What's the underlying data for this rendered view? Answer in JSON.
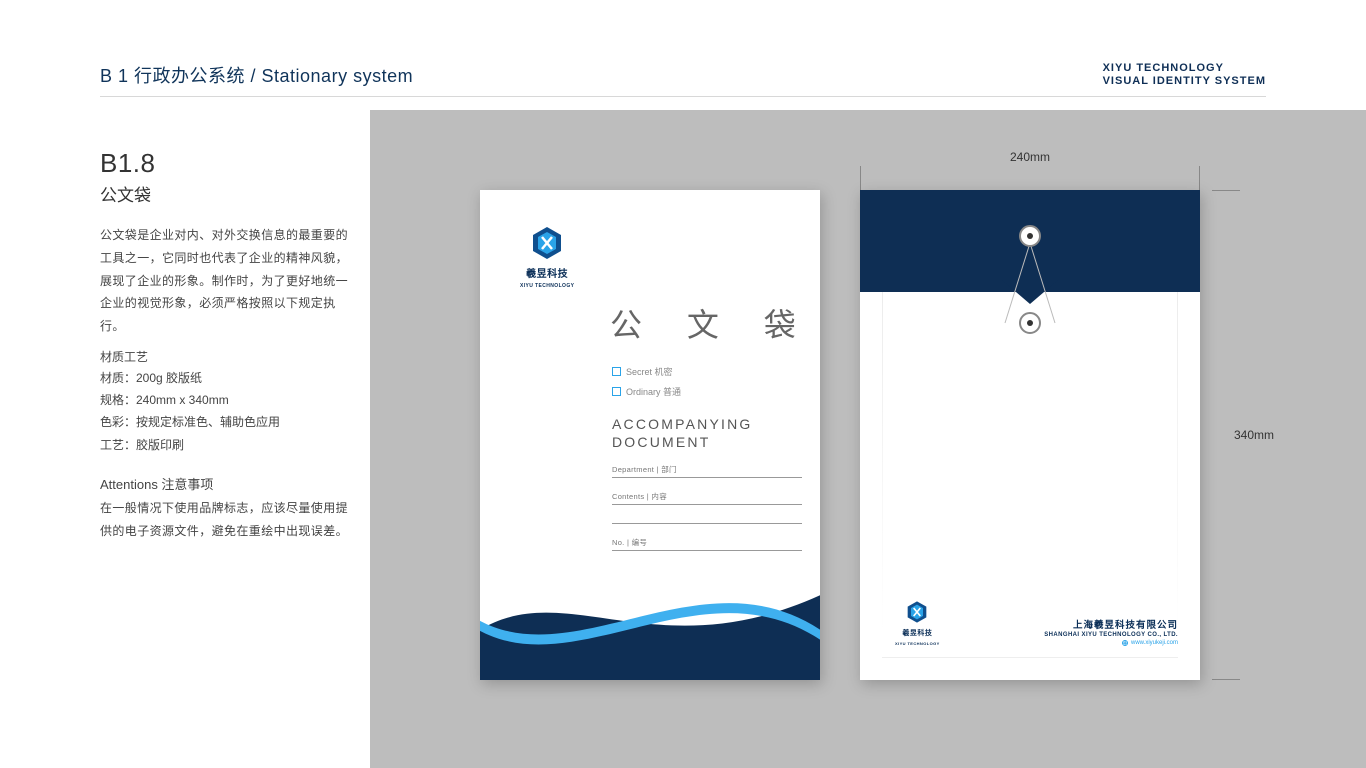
{
  "header": {
    "title": "B 1 行政办公系统 / Stationary system",
    "brand_line_1": "XIYU TECHNOLOGY",
    "brand_line_2": "VISUAL IDENTITY SYSTEM"
  },
  "sidebar": {
    "code": "B1.8",
    "item_name": "公文袋",
    "description": "公文袋是企业对内、对外交换信息的最重要的工具之一，它同时也代表了企业的精神风貌，展现了企业的形象。制作时，为了更好地统一企业的视觉形象，必须严格按照以下规定执行。",
    "material_title": "材质工艺",
    "specs": {
      "material": "材质：200g 胶版纸",
      "size": "规格：240mm x 340mm",
      "color": "色彩：按规定标准色、辅助色应用",
      "process": "工艺：胶版印刷"
    },
    "attention_title": "Attentions 注意事项",
    "attention_body": "在一般情况下使用品牌标志，应该尽量使用提供的电子资源文件，避免在重绘中出现误差。"
  },
  "logo": {
    "name_cn": "羲昱科技",
    "name_en": "XIYU TECHNOLOGY"
  },
  "front": {
    "title": "公 文 袋",
    "check_secret": "Secret 机密",
    "check_ordinary": "Ordinary 普通",
    "acc_line_1": "ACCOMPANYING",
    "acc_line_2": "DOCUMENT",
    "field_department": "Department | 部门",
    "field_contents": "Contents | 内容",
    "field_no": "No. | 编号"
  },
  "back": {
    "company_cn": "上海羲昱科技有限公司",
    "company_en": "SHANGHAI XIYU TECHNOLOGY CO., LTD.",
    "url": "www.xiyukeji.com"
  },
  "dimensions": {
    "width": "240mm",
    "height": "340mm"
  },
  "colors": {
    "brand_navy": "#0e2e54",
    "brand_blue": "#2aa3e8"
  }
}
